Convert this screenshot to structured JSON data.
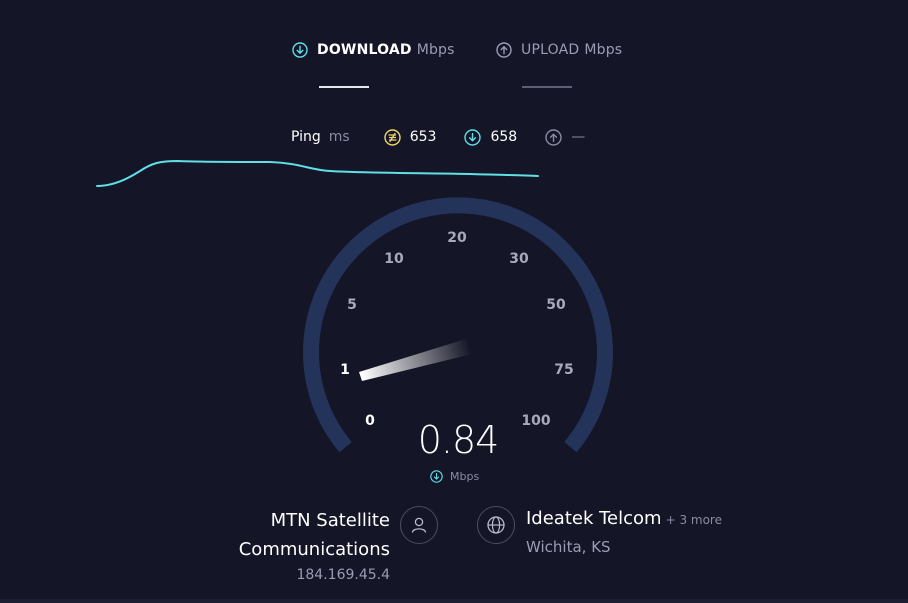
{
  "tabs": {
    "download": {
      "title": "DOWNLOAD",
      "unit": "Mbps",
      "active": true
    },
    "upload": {
      "title": "UPLOAD",
      "unit": "Mbps",
      "active": false
    }
  },
  "ping": {
    "label": "Ping",
    "unit": "ms",
    "idle": "653",
    "download": "658",
    "upload": "—"
  },
  "gauge": {
    "ticks": [
      "0",
      "1",
      "5",
      "10",
      "20",
      "30",
      "50",
      "75",
      "100"
    ],
    "value": "0.84",
    "unit": "Mbps"
  },
  "isp": {
    "name_line1": "MTN Satellite",
    "name_line2": "Communications",
    "ip": "184.169.45.4"
  },
  "server": {
    "name": "Ideatek Telcom",
    "more": "+ 3 more",
    "location": "Wichita, KS"
  },
  "colors": {
    "background": "#141526",
    "gauge_track": "#24335a",
    "accent_download": "#5ee0e6",
    "accent_ping": "#f1d86b"
  }
}
